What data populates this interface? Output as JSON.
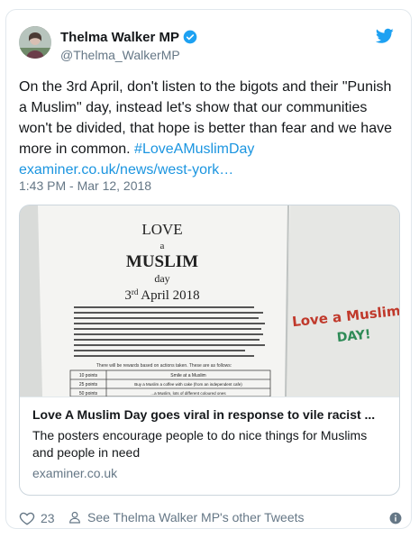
{
  "author": {
    "display_name": "Thelma Walker MP",
    "handle": "@Thelma_WalkerMP"
  },
  "tweet": {
    "text_plain": "On the 3rd April, don't listen to the bigots and their \"Punish a Muslim\" day, instead let's show that our communities won't be divided, that hope is better than fear and we have more in common. ",
    "hashtag": "#LoveAMuslimDay",
    "link": "examiner.co.uk/news/west-york…",
    "timestamp": "1:43 PM - Mar 12, 2018"
  },
  "card": {
    "title": "Love A Muslim Day goes viral in response to vile racist ...",
    "description": "The posters encourage people to do nice things for Muslims and people in need",
    "domain": "examiner.co.uk",
    "image_text": {
      "love": "LOVE",
      "a": "a",
      "muslim": "MUSLIM",
      "day": "day",
      "date_prefix": "3",
      "date_suffix": "rd",
      "date_rest": " April 2018",
      "table_caption": "There will be rewards based on actions taken. These are as follows:",
      "row1_points": "10 points",
      "row1_action": "Smile at a Muslim",
      "row2_points": "25 points",
      "row2_action": "Buy a Muslim a coffee with cake (from an independent cafe)",
      "row3_points": "50 points",
      "row3_action": "...a Muslim, lots of different coloured ones",
      "side_note_line1": "Love a Muslim",
      "side_note_line2": "DAY!"
    }
  },
  "actions": {
    "like_count": "23",
    "other_tweets": "See Thelma Walker MP's other Tweets"
  },
  "colors": {
    "link": "#1b95e0",
    "secondary_text": "#657786",
    "border": "#e1e8ed",
    "twitter_blue": "#1da1f2"
  },
  "icons": [
    "avatar",
    "verified-badge-icon",
    "twitter-logo-icon",
    "heart-icon",
    "person-icon",
    "info-icon"
  ]
}
